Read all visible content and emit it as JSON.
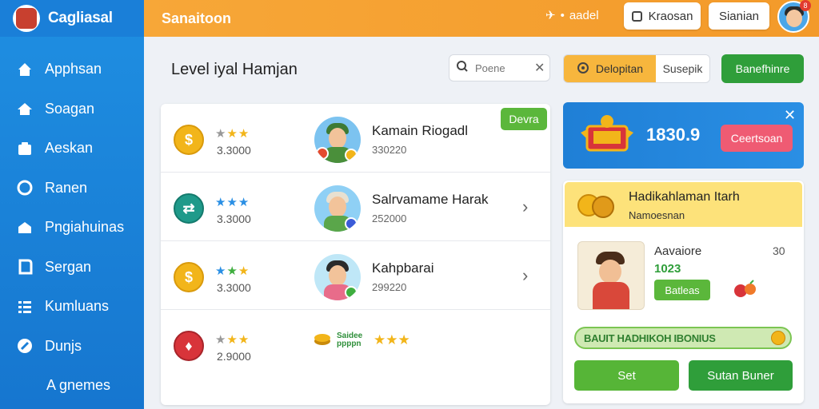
{
  "app": {
    "brand": "Cagliasal"
  },
  "sidebar": {
    "items": [
      {
        "label": "Apphsan",
        "icon": "home-icon"
      },
      {
        "label": "Soagan",
        "icon": "house-icon"
      },
      {
        "label": "Aeskan",
        "icon": "folder-icon"
      },
      {
        "label": "Ranen",
        "icon": "circle-icon"
      },
      {
        "label": "Pngiahuinas",
        "icon": "inbox-icon"
      },
      {
        "label": "Sergan",
        "icon": "bookmark-icon"
      },
      {
        "label": "Kumluans",
        "icon": "grid-icon"
      },
      {
        "label": "Dunjs",
        "icon": "compass-icon"
      },
      {
        "label": "A gnemes",
        "icon": ""
      }
    ]
  },
  "topbar": {
    "title": "Sanaitoon",
    "link": "aadel",
    "btn1": "Kraosan",
    "btn2": "Sianian",
    "badge": "8"
  },
  "main": {
    "title": "Level iyal Hamjan",
    "search_placeholder": "Poene",
    "seg_a": "Delopitan",
    "seg_b": "Susepik",
    "green_btn": "Banefhinre"
  },
  "list": {
    "tag": "Devra",
    "rows": [
      {
        "stars": "★★★",
        "score": "3.3000",
        "name": "Kamain Riogadl",
        "sub": "330220",
        "coin_color": "#f2b51a",
        "coin_symbol": "$",
        "has_chevron": false
      },
      {
        "stars": "★★★",
        "score": "3.3000",
        "name": "Salrvamame Harak",
        "sub": "252000",
        "coin_color": "#1f9a8a",
        "coin_symbol": "⇄",
        "has_chevron": true
      },
      {
        "stars": "★★★",
        "score": "3.3000",
        "name": "Kahpbarai",
        "sub": "299220",
        "coin_color": "#f2b51a",
        "coin_symbol": "$",
        "has_chevron": true
      },
      {
        "stars": "★★★",
        "score": "2.9000",
        "bonus": "Saidee ppppn",
        "coin_color": "#d8343a",
        "coin_symbol": "♦"
      }
    ]
  },
  "promo": {
    "value": "1830.9",
    "button": "Ceertsoan"
  },
  "reward": {
    "title": "Hadikahlaman Itarh",
    "subtitle": "Namoesnan",
    "char_name": "Aavaiore",
    "char_num": "1023",
    "char_btn": "Batleas",
    "code": "30",
    "progress_text": "BAUIT HADHIKOH IBONIUS",
    "btn1": "Set",
    "btn2": "Sutan Buner"
  },
  "colors": {
    "sidebar": "#1f8fe2",
    "topbar": "#f7a738",
    "green": "#2f9e3a",
    "promo": "#1f7fd6",
    "reward_head": "#fde27a"
  }
}
